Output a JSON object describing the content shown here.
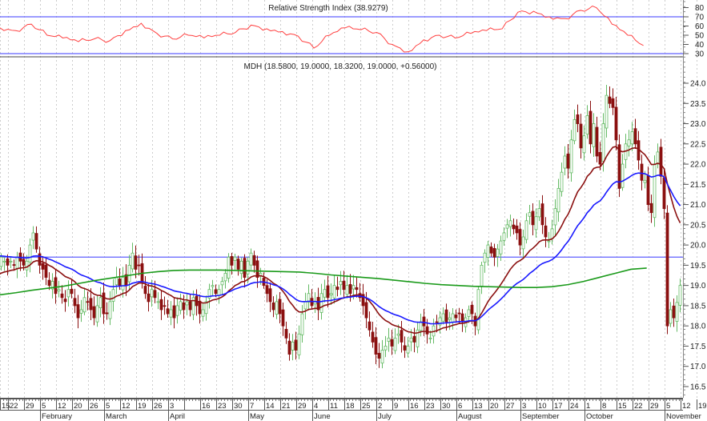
{
  "chart_data": {
    "type": "candlestick",
    "symbol_title": "MDH (18.5800, 19.0000, 18.3200, 19.0000, +0.56000)",
    "rsi": {
      "title": "Relative Strength Index (38.9279)",
      "ticks": [
        80,
        70,
        60,
        50,
        40,
        30
      ],
      "upper": 70,
      "lower": 30,
      "weekly_values": [
        58,
        55,
        62,
        50,
        47,
        43,
        46,
        44,
        55,
        63,
        52,
        46,
        50,
        47,
        50,
        53,
        61,
        57,
        54,
        49,
        36,
        50,
        58,
        56,
        53,
        40,
        32,
        45,
        50,
        47,
        52,
        55,
        57,
        75,
        76,
        70,
        68,
        77,
        80,
        62,
        50,
        38.9
      ]
    },
    "price": {
      "ylim": [
        16.25,
        24.4
      ],
      "ticks": [
        "24.0",
        "23.5",
        "23.0",
        "22.5",
        "22.0",
        "21.5",
        "21.0",
        "20.5",
        "20.0",
        "19.5",
        "19.0",
        "18.5",
        "18.0",
        "17.5",
        "17.0",
        "16.5"
      ],
      "horizontal_line": 19.7,
      "daily_closes": [
        19.6,
        19.5,
        19.7,
        19.6,
        19.5,
        19.6,
        19.5,
        19.7,
        19.6,
        19.5,
        19.6,
        20.0,
        20.3,
        19.9,
        19.5,
        19.4,
        19.2,
        19.0,
        19.1,
        18.8,
        18.9,
        18.7,
        18.6,
        18.9,
        18.8,
        18.5,
        18.2,
        18.4,
        18.7,
        18.6,
        18.4,
        18.2,
        18.5,
        18.7,
        18.3,
        18.3,
        18.6,
        18.9,
        19.2,
        19.0,
        19.2,
        19.0,
        19.5,
        19.8,
        19.4,
        19.5,
        19.1,
        18.8,
        18.6,
        18.9,
        18.7,
        18.6,
        18.4,
        18.5,
        18.3,
        18.4,
        18.2,
        18.5,
        18.6,
        18.4,
        18.6,
        18.4,
        18.7,
        18.5,
        18.3,
        18.4,
        18.6,
        18.9,
        19.0,
        18.8,
        18.9,
        19.1,
        19.3,
        19.7,
        19.5,
        19.7,
        19.4,
        19.6,
        19.2,
        19.6,
        19.8,
        19.5,
        19.2,
        19.3,
        19.0,
        18.8,
        18.6,
        18.4,
        18.6,
        18.3,
        18.0,
        17.7,
        17.3,
        17.6,
        17.4,
        17.8,
        18.3,
        18.6,
        18.8,
        18.5,
        18.6,
        18.4,
        18.8,
        18.9,
        18.7,
        18.8,
        19.0,
        18.9,
        19.1,
        18.9,
        19.0,
        18.8,
        19.0,
        18.9,
        18.7,
        18.5,
        18.2,
        17.9,
        17.6,
        17.3,
        17.2,
        17.4,
        17.5,
        17.7,
        17.5,
        17.7,
        17.8,
        17.6,
        17.4,
        17.5,
        17.7,
        17.6,
        17.9,
        18.1,
        18.0,
        17.8,
        17.7,
        18.0,
        18.1,
        18.2,
        18.3,
        18.1,
        18.2,
        18.3,
        18.2,
        18.3,
        18.1,
        18.2,
        18.4,
        18.3,
        18.0,
        18.9,
        19.5,
        19.8,
        20.0,
        19.8,
        19.7,
        19.9,
        20.1,
        20.3,
        20.5,
        20.6,
        20.4,
        20.3,
        20.0,
        20.2,
        20.6,
        20.8,
        20.5,
        20.7,
        20.9,
        20.5,
        20.2,
        20.1,
        20.4,
        20.9,
        21.4,
        21.8,
        22.2,
        21.9,
        22.6,
        23.1,
        23.0,
        22.4,
        22.7,
        23.2,
        22.5,
        23.0,
        22.2,
        22.0,
        23.0,
        23.7,
        23.5,
        23.4,
        22.6,
        21.4,
        22.0,
        22.5,
        22.6,
        22.8,
        22.5,
        22.1,
        21.6,
        21.6,
        21.0,
        20.8,
        22.0,
        22.3,
        21.7,
        20.9,
        18.0,
        18.4,
        18.2,
        18.58,
        19.0
      ],
      "ma_long_weekly": [
        18.77,
        18.82,
        18.88,
        18.93,
        18.98,
        19.05,
        19.12,
        19.18,
        19.24,
        19.3,
        19.34,
        19.37,
        19.38,
        19.38,
        19.38,
        19.37,
        19.36,
        19.35,
        19.34,
        19.33,
        19.3,
        19.26,
        19.23,
        19.2,
        19.17,
        19.13,
        19.09,
        19.05,
        19.02,
        19.0,
        18.98,
        18.97,
        18.96,
        18.95,
        18.95,
        18.97,
        19.02,
        19.1,
        19.2,
        19.3,
        19.4,
        19.43
      ],
      "colors": {
        "up": "#66bb66",
        "down": "#8b1010",
        "ma_fast": "#8b1010",
        "ma_mid": "#1a1aff",
        "ma_long": "#1a9a1a",
        "level": "#6060ff",
        "rsi": "#ff4040"
      }
    },
    "x_axis": {
      "week_labels": [
        "15",
        "22",
        "29",
        "5",
        "12",
        "20",
        "26",
        "5",
        "12",
        "19",
        "26",
        "3",
        "",
        "16",
        "23",
        "30",
        "7",
        "14",
        "21",
        "29",
        "4",
        "11",
        "18",
        "25",
        "2",
        "9",
        "16",
        "23",
        "30",
        "6",
        "13",
        "20",
        "27",
        "3",
        "10",
        "17",
        "24",
        "1",
        "8",
        "15",
        "22",
        "29",
        "5",
        "12",
        "19"
      ],
      "months": [
        {
          "label": "February",
          "week": 3
        },
        {
          "label": "March",
          "week": 7
        },
        {
          "label": "April",
          "week": 11
        },
        {
          "label": "May",
          "week": 16
        },
        {
          "label": "June",
          "week": 20
        },
        {
          "label": "July",
          "week": 24
        },
        {
          "label": "August",
          "week": 29
        },
        {
          "label": "September",
          "week": 33
        },
        {
          "label": "October",
          "week": 37
        },
        {
          "label": "November",
          "week": 42
        }
      ]
    }
  }
}
